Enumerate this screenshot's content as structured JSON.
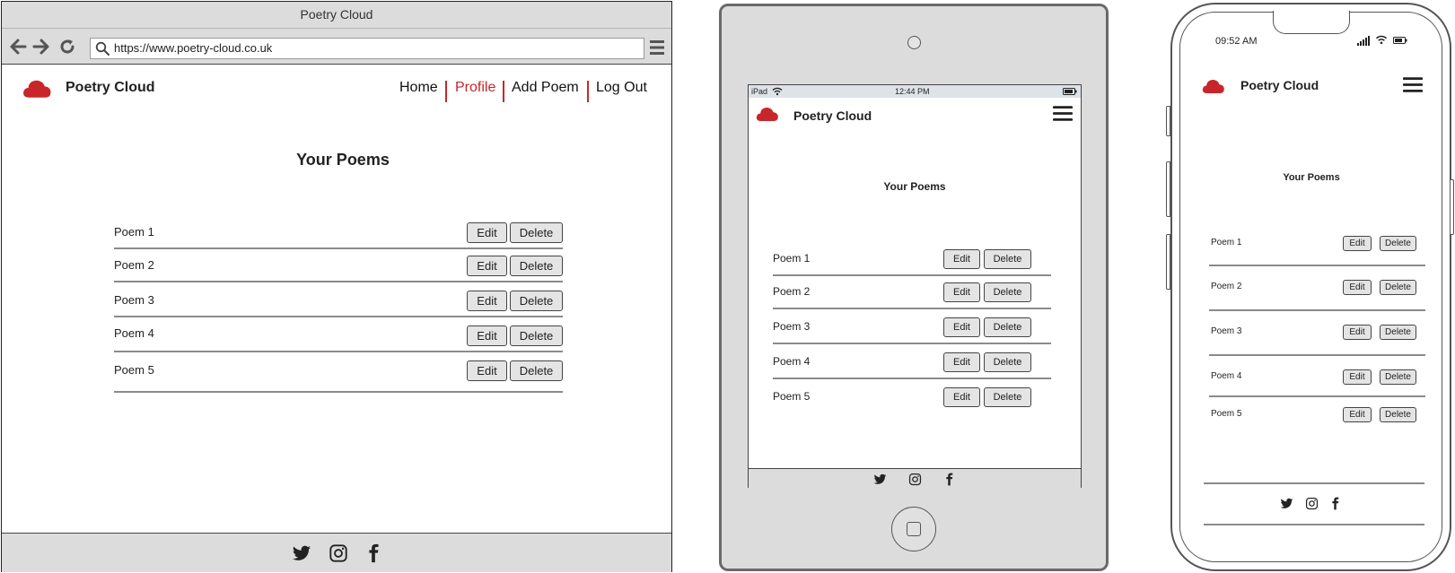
{
  "desktop": {
    "window_title": "Poetry Cloud",
    "url": "https://www.poetry-cloud.co.uk",
    "brand": "Poetry Cloud",
    "nav": {
      "home": "Home",
      "profile": "Profile",
      "add_poem": "Add Poem",
      "log_out": "Log Out"
    },
    "page_title": "Your Poems",
    "poems": [
      "Poem 1",
      "Poem 2",
      "Poem 3",
      "Poem 4",
      "Poem 5"
    ],
    "edit_label": "Edit",
    "delete_label": "Delete"
  },
  "tablet": {
    "status": {
      "device": "iPad",
      "time": "12:44 PM"
    },
    "brand": "Poetry Cloud",
    "page_title": "Your Poems",
    "poems": [
      "Poem 1",
      "Poem 2",
      "Poem 3",
      "Poem 4",
      "Poem 5"
    ],
    "edit_label": "Edit",
    "delete_label": "Delete"
  },
  "phone": {
    "status": {
      "time": "09:52 AM"
    },
    "brand": "Poetry Cloud",
    "page_title": "Your Poems",
    "poems": [
      "Poem 1",
      "Poem 2",
      "Poem 3",
      "Poem 4",
      "Poem 5"
    ],
    "edit_label": "Edit",
    "delete_label": "Delete"
  },
  "colors": {
    "accent": "#c8262a",
    "chrome_gray": "#dcdcdc",
    "button_gray": "#e4e4e4"
  },
  "icons": [
    "cloud-logo-icon",
    "back-arrow-icon",
    "forward-arrow-icon",
    "reload-icon",
    "search-icon",
    "hamburger-menu-icon",
    "twitter-icon",
    "instagram-icon",
    "facebook-icon",
    "wifi-icon",
    "signal-icon",
    "battery-icon"
  ]
}
